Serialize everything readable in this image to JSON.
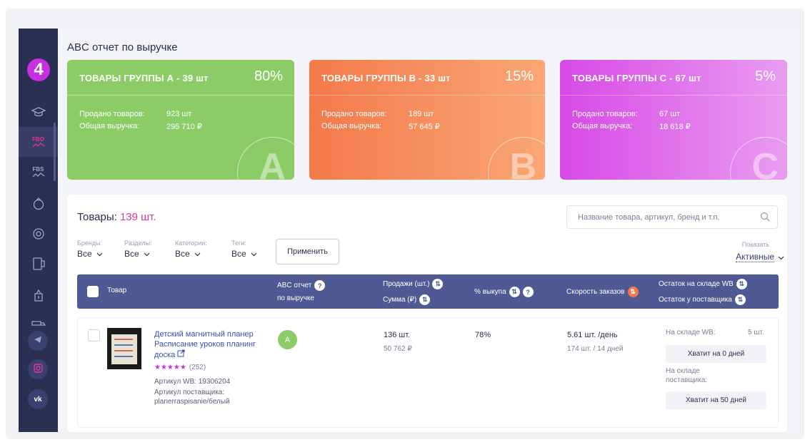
{
  "sidebar": {
    "logo": "4",
    "fbo_label": "FBO",
    "fbs_label": "FBS",
    "icons": [
      "graduation-cap-icon",
      "fbo-chart-icon",
      "fbs-chart-icon",
      "bag-icon",
      "coin-icon",
      "wallet-icon",
      "money-bag-icon",
      "truck-icon",
      "telegram-icon",
      "instagram-icon",
      "vk-icon"
    ],
    "social_vk": "vk"
  },
  "page": {
    "title": "ABC отчет по выручке"
  },
  "groups": [
    {
      "title": "ТОВАРЫ ГРУППЫ А - 39 шт",
      "percent": "80%",
      "sold_label": "Продано товаров:",
      "sold_value": "923 шт",
      "revenue_label": "Общая выручка:",
      "revenue_value": "295 710 ₽",
      "letter": "A",
      "color": "#8ccc66"
    },
    {
      "title": "ТОВАРЫ ГРУППЫ В - 33 шт",
      "percent": "15%",
      "sold_label": "Продано товаров:",
      "sold_value": "189 шт",
      "revenue_label": "Общая выручка:",
      "revenue_value": "57 645 ₽",
      "letter": "B",
      "color": "#f4794a"
    },
    {
      "title": "ТОВАРЫ ГРУППЫ С - 67 шт",
      "percent": "5%",
      "sold_label": "Продано товаров:",
      "sold_value": "67 шт",
      "revenue_label": "Общая выручка:",
      "revenue_value": "18 618 ₽",
      "letter": "C",
      "color": "#d749e6"
    }
  ],
  "products": {
    "title": "Товары:",
    "count": "139 шт.",
    "search_placeholder": "Название товара, артикул, бренд и т.п.",
    "filters": [
      {
        "label": "Бренды:",
        "value": "Все"
      },
      {
        "label": "Разделы:",
        "value": "Все"
      },
      {
        "label": "Категории:",
        "value": "Все"
      },
      {
        "label": "Теги:",
        "value": "Все"
      }
    ],
    "apply_label": "Применить",
    "show_label": "Показать",
    "show_value": "Активные",
    "columns": {
      "product": "Товар",
      "abc_line1": "ABC отчет",
      "abc_line2": "по выручке",
      "sales_line1": "Продажи (шт.)",
      "sales_line2": "Сумма (₽)",
      "buyout": "% выкупа",
      "speed": "Скорость заказов",
      "stock_line1": "Остаток на складе WB",
      "stock_line2": "Остаток у поставщика"
    },
    "rows": [
      {
        "name": "Детский магнитный планер Расписание уроков планинг доска",
        "rating_stars": "★★★★★",
        "rating_count": "(252)",
        "article_wb": "Артикул WB: 19306204",
        "article_supplier_label": "Артикул поставщика:",
        "article_supplier": "planerraspisanie/белый",
        "abc_group": "A",
        "sales_qty": "136 шт.",
        "sales_sum": "50 762 ₽",
        "buyout": "78%",
        "speed": "5.61 шт. /день",
        "speed_sub": "174 шт. / 14 дней",
        "wb_stock_label": "На складе WB:",
        "wb_stock_value": "5 шт.",
        "wb_enough": "Хватит на 0 дней",
        "supplier_label": "На складе поставщика:",
        "supplier_enough": "Хватит на 50 дней"
      }
    ]
  }
}
